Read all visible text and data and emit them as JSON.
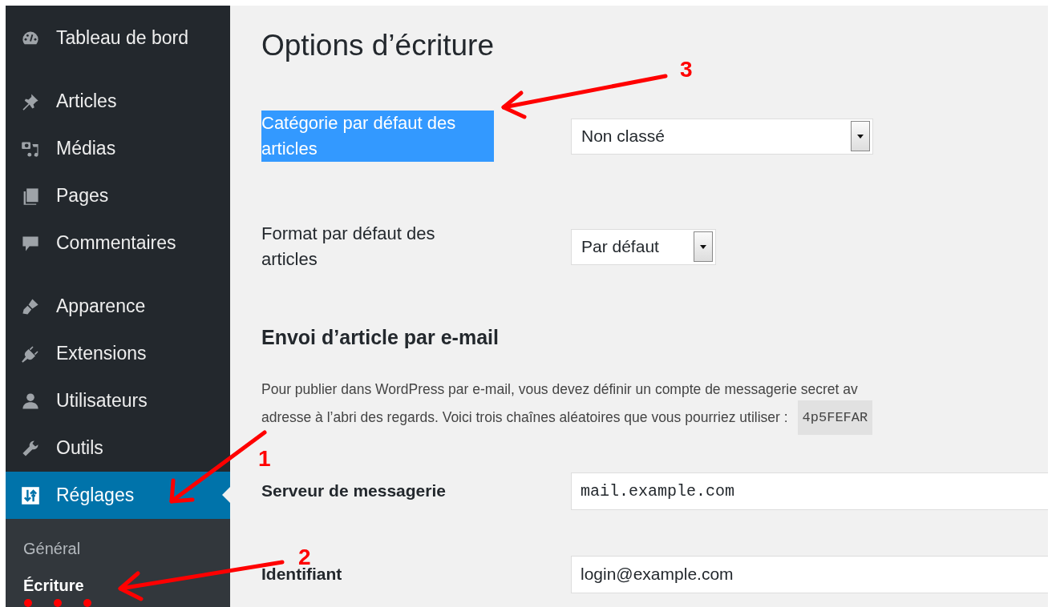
{
  "sidebar": {
    "menu_groups": [
      [
        {
          "label": "Tableau de bord",
          "selected": false
        }
      ],
      [
        {
          "label": "Articles",
          "selected": false
        },
        {
          "label": "Médias",
          "selected": false
        },
        {
          "label": "Pages",
          "selected": false
        },
        {
          "label": "Commentaires",
          "selected": false
        }
      ],
      [
        {
          "label": "Apparence",
          "selected": false
        },
        {
          "label": "Extensions",
          "selected": false
        },
        {
          "label": "Utilisateurs",
          "selected": false
        },
        {
          "label": "Outils",
          "selected": false
        },
        {
          "label": "Réglages",
          "selected": true
        }
      ]
    ],
    "submenu": [
      {
        "label": "Général",
        "selected": false
      },
      {
        "label": "Écriture",
        "selected": true
      }
    ]
  },
  "page_title": "Options d’écriture",
  "settings": [
    {
      "label": "Catégorie par défaut des articles",
      "label_highlighted": true,
      "kind": "select",
      "value": "Non classé"
    },
    {
      "label": "Format par défaut des articles",
      "label_highlighted": false,
      "kind": "select",
      "value": "Par défaut"
    }
  ],
  "email_section": {
    "heading": "Envoi d’article par e-mail",
    "paragraph_lines": [
      "Pour publier dans WordPress par e-mail, vous devez définir un compte de messagerie secret av",
      "adresse à l’abri des regards. Voici trois chaînes aléatoires que vous pourriez utiliser :"
    ],
    "code": "4p5FEFAR",
    "fields": [
      {
        "label": "Serveur de messagerie",
        "kind": "mono",
        "value": "mail.example.com"
      },
      {
        "label": "Identifiant",
        "kind": "text",
        "value": "login@example.com"
      }
    ]
  },
  "annotations": [
    {
      "number": "3"
    },
    {
      "number": "1"
    },
    {
      "number": "2"
    }
  ]
}
